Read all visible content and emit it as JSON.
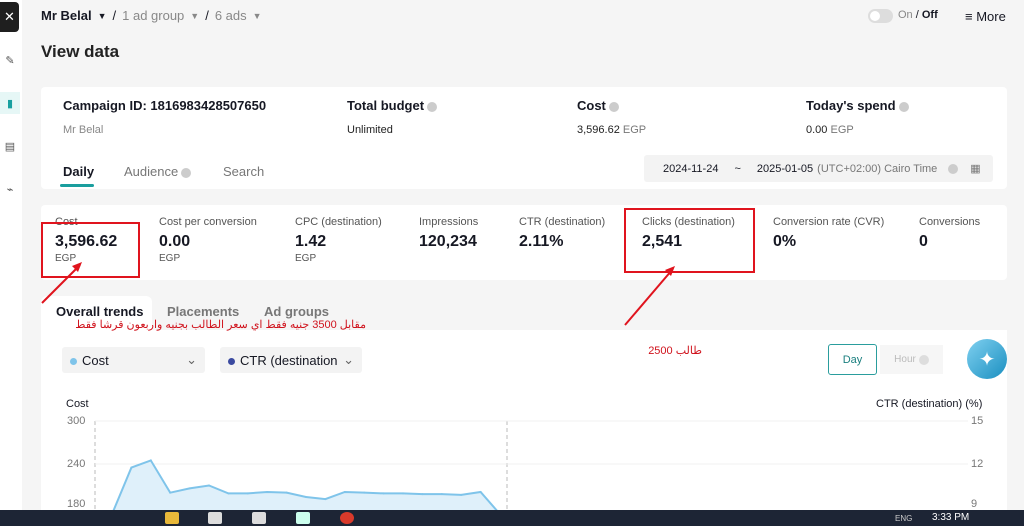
{
  "header": {
    "campaign": "Mr Belal",
    "ad_group": "1 ad group",
    "ads": "6 ads",
    "title": "View data",
    "toggle_on": "On",
    "toggle_sep": "/",
    "toggle_off": "Off",
    "more": "More"
  },
  "summary": {
    "campaign_id": "Campaign ID: 1816983428507650",
    "campaign_name": "Mr Belal",
    "total_budget_label": "Total budget",
    "total_budget": "Unlimited",
    "cost_label": "Cost",
    "cost_value": "3,596.62",
    "cost_unit": "EGP",
    "todays_spend_label": "Today's spend",
    "todays_spend_value": "0.00",
    "todays_spend_unit": "EGP"
  },
  "tabs": [
    {
      "label": "Daily",
      "active": true
    },
    {
      "label": "Audience"
    },
    {
      "label": "Search"
    }
  ],
  "date_range": {
    "start": "2024-11-24",
    "sep": "~",
    "end": "2025-01-05",
    "tz": "(UTC+02:00) Cairo Time"
  },
  "metrics": [
    {
      "label": "Cost",
      "value": "3,596.62",
      "unit": "EGP"
    },
    {
      "label": "Cost per conversion",
      "value": "0.00",
      "unit": "EGP"
    },
    {
      "label": "CPC (destination)",
      "value": "1.42",
      "unit": "EGP"
    },
    {
      "label": "Impressions",
      "value": "120,234"
    },
    {
      "label": "CTR (destination)",
      "value": "2.11%"
    },
    {
      "label": "Clicks (destination)",
      "value": "2,541"
    },
    {
      "label": "Conversion rate (CVR)",
      "value": "0%"
    },
    {
      "label": "Conversions",
      "value": "0"
    }
  ],
  "trend_tabs": [
    "Overall trends",
    "Placements",
    "Ad groups"
  ],
  "selectors": [
    {
      "label": "Cost",
      "color": "#7fc4ea"
    },
    {
      "label": "CTR (destination",
      "color": "#3b4aa0"
    }
  ],
  "granularity": {
    "day": "Day",
    "hour": "Hour"
  },
  "annotations": {
    "note1": "مقابل 3500 جنيه فقط اي سعر الطالب بجنيه واربعون قرشا فقط",
    "note2": "طالب 2500",
    "color": "#e0141e"
  },
  "chart_data": {
    "type": "area",
    "left_axis_label": "Cost",
    "right_axis_label": "CTR (destination) (%)",
    "left_ticks": [
      "300",
      "240",
      "180"
    ],
    "right_ticks": [
      "15",
      "12",
      "9"
    ],
    "ylim_left": [
      180,
      300
    ],
    "ylim_right": [
      9,
      15
    ],
    "series": [
      {
        "name": "Cost",
        "color": "#7fc4ea",
        "values": [
          170,
          235,
          245,
          200,
          206,
          210,
          199,
          199,
          201,
          200,
          194,
          191,
          201,
          200,
          199,
          199,
          198,
          198,
          197,
          201,
          170
        ]
      }
    ]
  },
  "taskbar": {
    "time": "3:33 PM",
    "lang": "ENG"
  }
}
